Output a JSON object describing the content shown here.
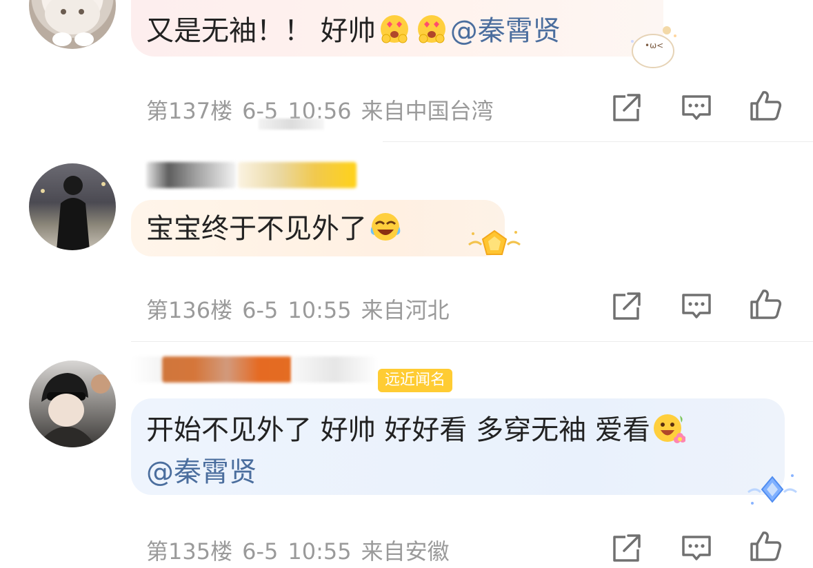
{
  "comments": [
    {
      "text_parts": [
        "又是无袖！！ 好帅"
      ],
      "mention": "@秦霄贤",
      "floor": "第137楼",
      "date": "6-5",
      "time": "10:56",
      "location": "来自中国台湾"
    },
    {
      "text_parts": [
        "宝宝终于不见外了"
      ],
      "floor": "第136楼",
      "date": "6-5",
      "time": "10:55",
      "location": "来自河北"
    },
    {
      "text_parts": [
        "开始不见外了 好帅 好好看 多穿无袖 爱看"
      ],
      "mention": "@秦霄贤",
      "badge": "远近闻名",
      "floor": "第135楼",
      "date": "6-5",
      "time": "10:55",
      "location": "来自安徽"
    }
  ],
  "icons": {
    "share": "share-icon",
    "comment": "comment-icon",
    "like": "thumbs-up-icon",
    "emoji_heart_eyes": "heart-eyes-emoji-icon",
    "emoji_laugh_cry": "laughing-crying-emoji-icon",
    "emoji_flower": "smile-flower-emoji-icon"
  },
  "colors": {
    "mention": "#4b6e9e",
    "meta_text": "#9a9a9a",
    "badge_bg": "#ffcc33",
    "bubble_pink": "#fdecec",
    "bubble_peach": "#fff1e3",
    "bubble_blue": "#eaf1fc"
  }
}
